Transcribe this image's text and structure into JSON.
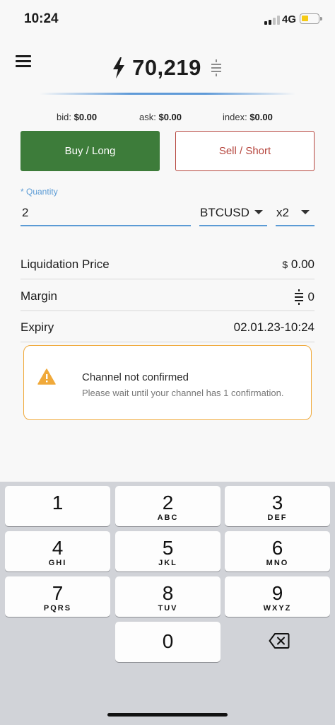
{
  "status_bar": {
    "time": "10:24",
    "network": "4G",
    "battery_color": "#f6cb16"
  },
  "header": {
    "balance": "70,219",
    "balance_unit_icon": "sats-icon",
    "lightning_icon": "lightning-bolt-icon",
    "menu_icon": "hamburger-menu-icon"
  },
  "prices": {
    "bid_label": "bid:",
    "bid_value": "$0.00",
    "ask_label": "ask:",
    "ask_value": "$0.00",
    "index_label": "index:",
    "index_value": "$0.00"
  },
  "actions": {
    "buy_label": "Buy / Long",
    "sell_label": "Sell / Short",
    "buy_color": "#3d7c3a",
    "sell_color": "#b5443c"
  },
  "form": {
    "quantity_label": "* Quantity",
    "quantity_value": "2",
    "contract_value": "BTCUSD",
    "leverage_value": "x2",
    "accent_color": "#5b9bd5"
  },
  "details": {
    "liquidation_label": "Liquidation Price",
    "liquidation_currency": "$",
    "liquidation_value": "0.00",
    "margin_label": "Margin",
    "margin_value": "0",
    "expiry_label": "Expiry",
    "expiry_value": "02.01.23-10:24"
  },
  "alert": {
    "title": "Channel not confirmed",
    "message": "Please wait until your channel has 1 confirmation.",
    "border_color": "#f0a93a",
    "icon": "warning-icon"
  },
  "keypad": {
    "keys": [
      {
        "num": "1",
        "letters": ""
      },
      {
        "num": "2",
        "letters": "ABC"
      },
      {
        "num": "3",
        "letters": "DEF"
      },
      {
        "num": "4",
        "letters": "GHI"
      },
      {
        "num": "5",
        "letters": "JKL"
      },
      {
        "num": "6",
        "letters": "MNO"
      },
      {
        "num": "7",
        "letters": "PQRS"
      },
      {
        "num": "8",
        "letters": "TUV"
      },
      {
        "num": "9",
        "letters": "WXYZ"
      },
      {
        "num": "0",
        "letters": ""
      }
    ],
    "delete_icon": "backspace-icon"
  }
}
